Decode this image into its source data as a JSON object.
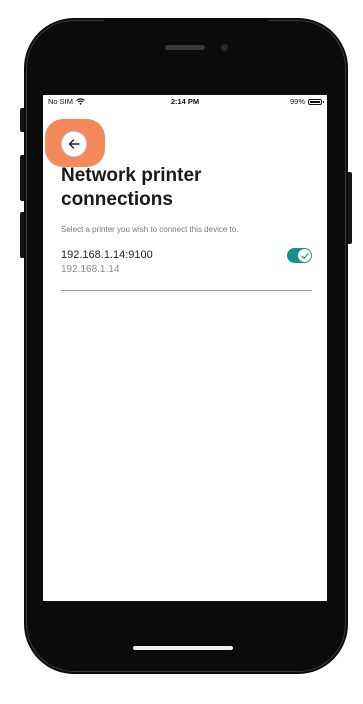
{
  "status_bar": {
    "carrier": "No SIM",
    "time": "2:14 PM",
    "battery": "99%"
  },
  "page": {
    "back_icon": "arrow-left-icon",
    "title": "Network printer connections",
    "subtitle": "Select a printer you wish to connect this device to."
  },
  "printers": [
    {
      "name": "192.168.1.14:9100",
      "ip": "192.168.1.14",
      "connected": true
    }
  ],
  "colors": {
    "accent": "#15918f",
    "highlight": "#f48a5b",
    "device": "#0b0b0b"
  }
}
